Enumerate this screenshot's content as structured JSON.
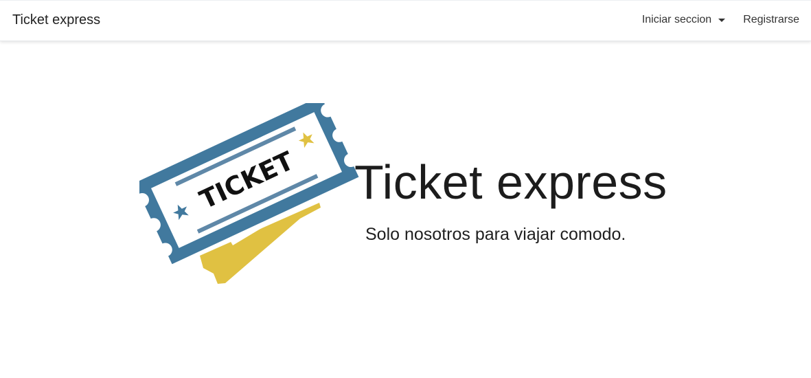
{
  "navbar": {
    "brand": "Ticket express",
    "login_label": "Iniciar seccion",
    "register_label": "Registrarse"
  },
  "hero": {
    "logo_text": "TICKET",
    "title": "Ticket express",
    "subtitle": "Solo nosotros para viajar comodo."
  },
  "colors": {
    "ticket_blue": "#41799e",
    "ticket_line_blue": "#5f88a8",
    "ticket_gold": "#e0c142",
    "text_dark": "#1c1c1c"
  },
  "icons": [
    "ticket-logo-icon",
    "star-icon",
    "caret-down-icon"
  ]
}
